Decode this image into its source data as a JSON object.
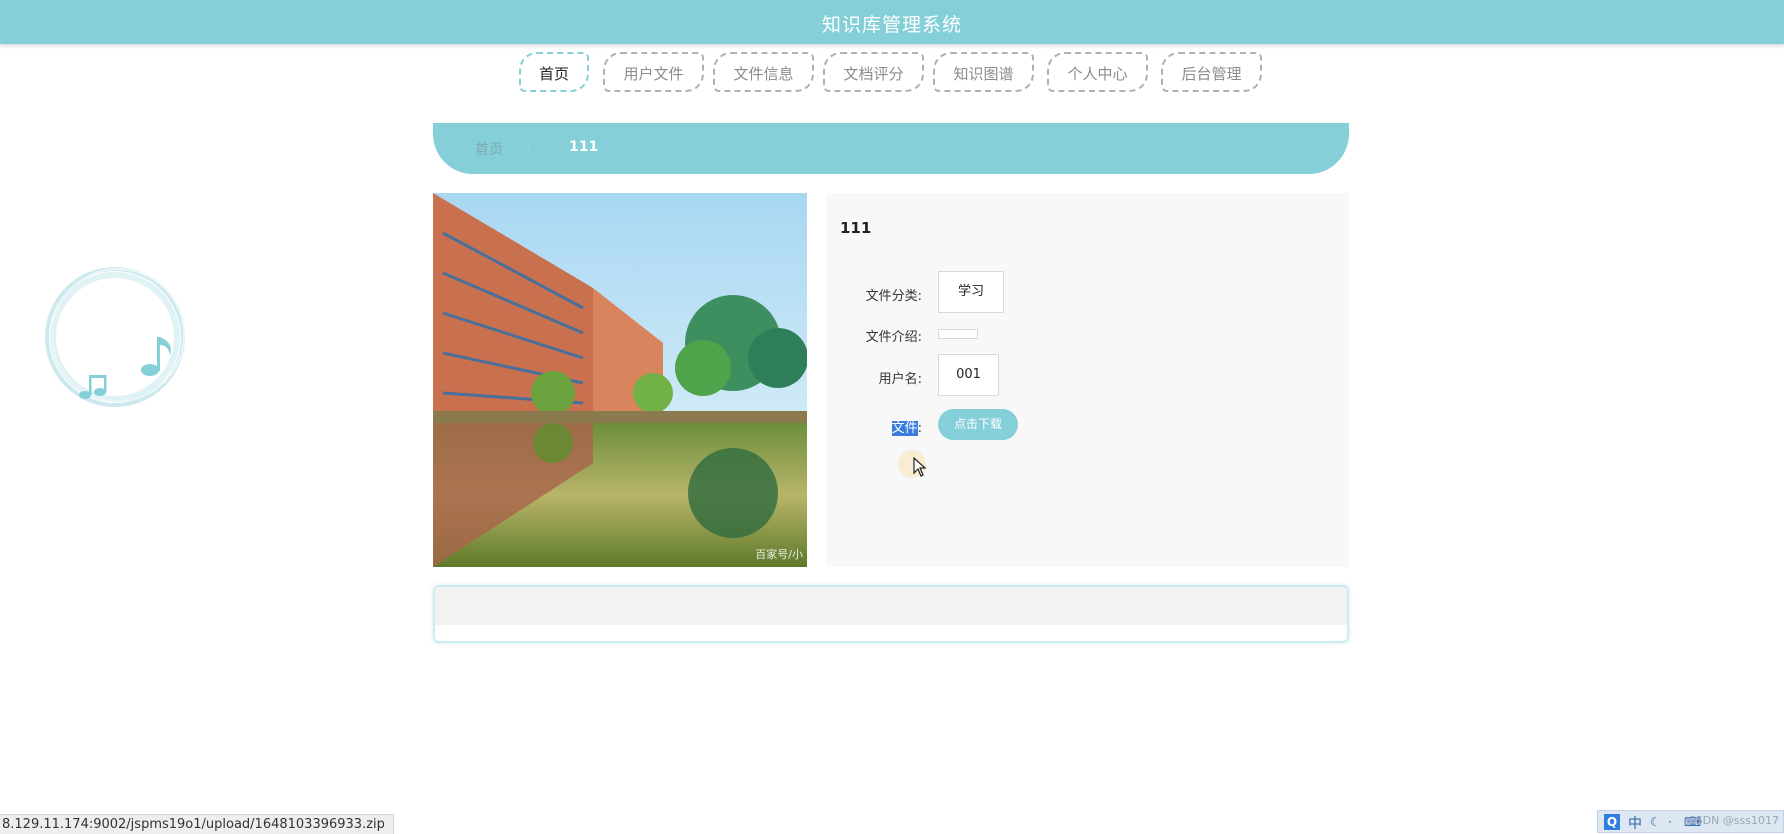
{
  "header": {
    "title": "知识库管理系统"
  },
  "nav": {
    "items": [
      {
        "label": "首页",
        "active": true
      },
      {
        "label": "用户文件",
        "active": false
      },
      {
        "label": "文件信息",
        "active": false
      },
      {
        "label": "文档评分",
        "active": false
      },
      {
        "label": "知识图谱",
        "active": false
      },
      {
        "label": "个人中心",
        "active": false
      },
      {
        "label": "后台管理",
        "active": false
      }
    ]
  },
  "breadcrumb": {
    "home": "首页",
    "separator": "/",
    "current": "111"
  },
  "photo": {
    "watermark": "百家号/小"
  },
  "detail": {
    "title": "111",
    "fields": {
      "category": {
        "label": "文件分类:",
        "value": "学习"
      },
      "intro": {
        "label": "文件介绍:",
        "value": ""
      },
      "username": {
        "label": "用户名:",
        "value": "001"
      },
      "file": {
        "label": "文件:",
        "selected_part": "文件",
        "rest": ":"
      }
    },
    "download_label": "点击下载"
  },
  "statusbar": {
    "url": "8.129.11.174:9002/jspms19o1/upload/1648103396933.zip"
  },
  "tray": {
    "q_label": "Q",
    "ime_label": "中",
    "credit": "CSDN @sss1017"
  },
  "colors": {
    "accent": "#84cfd8",
    "selection": "#3b7ddd"
  },
  "icons": {
    "music": "music-note-icon",
    "cursor": "mouse-pointer-icon"
  }
}
